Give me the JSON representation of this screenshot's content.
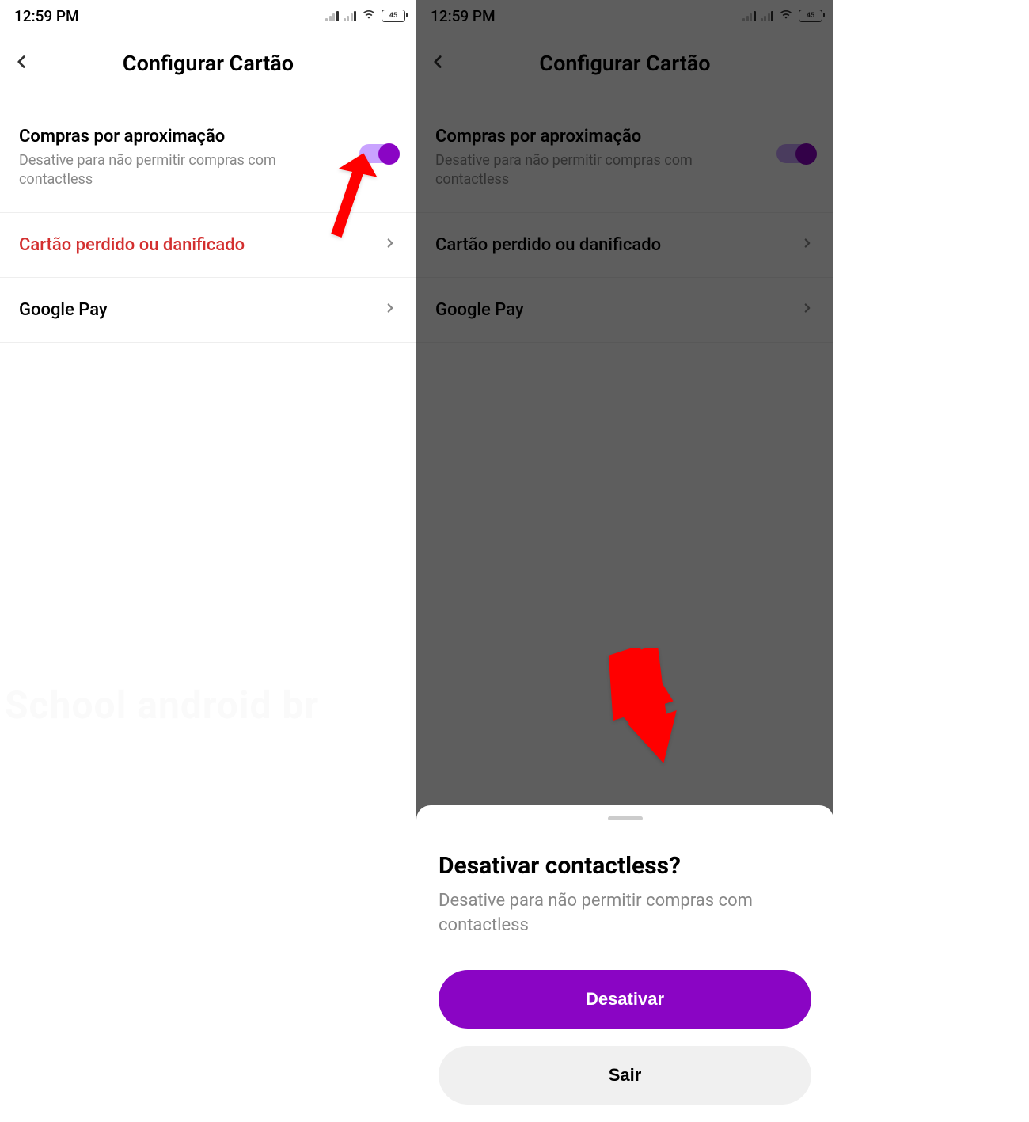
{
  "status": {
    "time": "12:59 PM",
    "battery": "45"
  },
  "header": {
    "title": "Configurar Cartão"
  },
  "contactless": {
    "title": "Compras por aproximação",
    "description": "Desative para não permitir compras com contactless"
  },
  "menu": {
    "lost_card": "Cartão perdido ou danificado",
    "google_pay": "Google Pay"
  },
  "sheet": {
    "title": "Desativar contactless?",
    "description": "Desative para não permitir compras com contactless",
    "primary_btn": "Desativar",
    "secondary_btn": "Sair"
  },
  "watermark": "School android br"
}
